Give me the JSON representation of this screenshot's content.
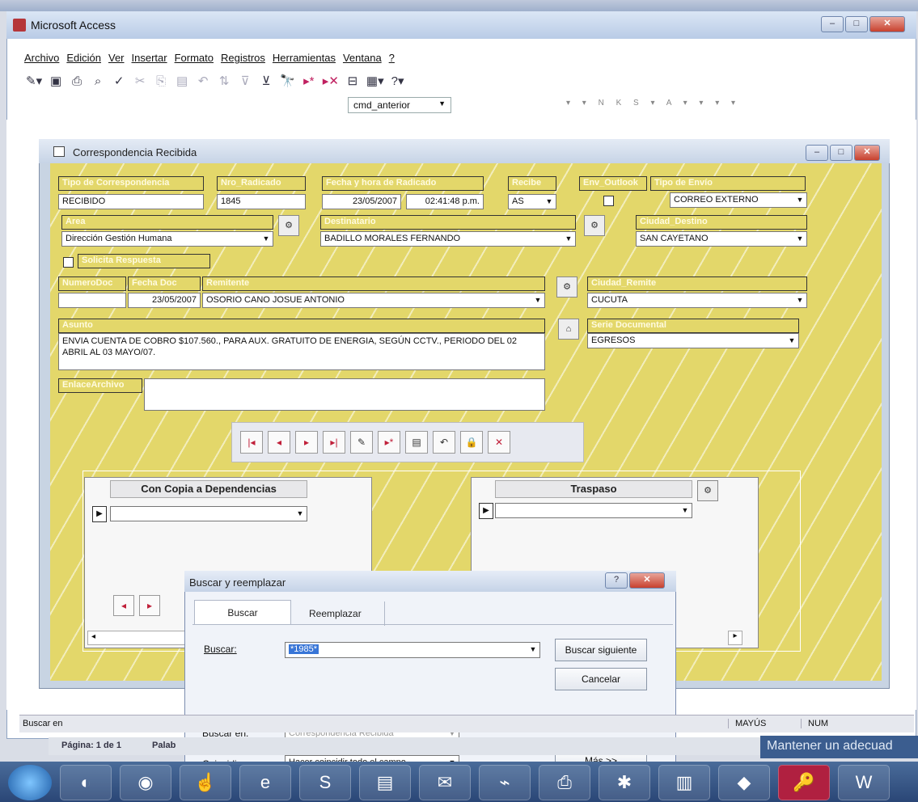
{
  "app": {
    "title": "Microsoft Access",
    "menu": [
      "Archivo",
      "Edición",
      "Ver",
      "Insertar",
      "Formato",
      "Registros",
      "Herramientas",
      "Ventana",
      "?"
    ],
    "object_box": "cmd_anterior"
  },
  "form": {
    "title": "Correspondencia Recibida",
    "labels": {
      "tipo_correspondencia": "Tipo de Correspondencia",
      "nro_radicado": "Nro_Radicado",
      "fecha_hora": "Fecha y hora de Radicado",
      "recibe": "Recibe",
      "env_outlook": "Env_Outlook",
      "tipo_envio": "Tipo de Envío",
      "area": "Area",
      "destinatario": "Destinatario",
      "ciudad_destino": "Ciudad_Destino",
      "solicita_respuesta": "Solicita Respuesta",
      "numero_doc": "NumeroDoc",
      "fecha_doc": "Fecha Doc",
      "remitente": "Remitente",
      "ciudad_remite": "Ciudad_Remite",
      "asunto": "Asunto",
      "serie_documental": "Serie Documental",
      "enlace_archivo": "EnlaceArchivo"
    },
    "values": {
      "tipo_correspondencia": "RECIBIDO",
      "nro_radicado": "1845",
      "fecha": "23/05/2007",
      "hora": "02:41:48 p.m.",
      "recibe": "AS",
      "tipo_envio": "CORREO EXTERNO",
      "area": "Dirección Gestión Humana",
      "destinatario": "BADILLO MORALES FERNANDO",
      "ciudad_destino": "SAN CAYETANO",
      "numero_doc": "",
      "fecha_doc": "23/05/2007",
      "remitente": "OSORIO CANO JOSUE ANTONIO",
      "ciudad_remite": "CUCUTA",
      "asunto": "ENVIA CUENTA DE COBRO $107.560., PARA AUX. GRATUITO DE ENERGIA, SEGÚN CCTV., PERIODO DEL 02 ABRIL AL 03 MAYO/07.",
      "serie_documental": "EGRESOS",
      "enlace_archivo": ""
    },
    "subforms": {
      "copia_header": "Con Copia a Dependencias",
      "traspaso_header": "Traspaso"
    }
  },
  "dialog": {
    "title": "Buscar y reemplazar",
    "tabs": [
      "Buscar",
      "Reemplazar"
    ],
    "buscar_label": "Buscar:",
    "buscar_value": "*1985*",
    "buscar_siguiente": "Buscar siguiente",
    "cancelar": "Cancelar",
    "buscar_en_label": "Buscar en:",
    "buscar_en_value": "Correspondencia Recibida",
    "coincidir_label": "Coincidir:",
    "coincidir_value": "Hacer coincidir todo el campo",
    "mas": "Más >>"
  },
  "status": {
    "left": "Buscar en",
    "mayus": "MAYÚS",
    "num": "NUM"
  },
  "word": {
    "pagina": "Página: 1 de 1",
    "palabras": "Palab",
    "mantener": "Mantener un adecuad"
  }
}
